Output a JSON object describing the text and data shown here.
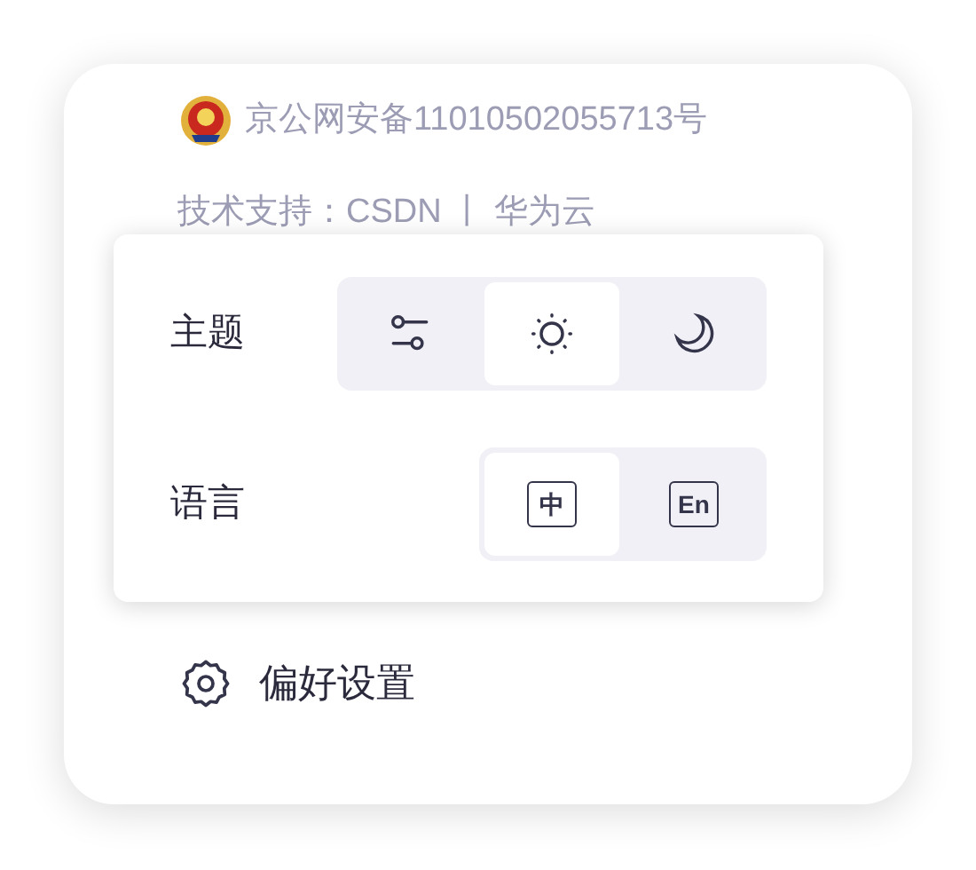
{
  "footer": {
    "icp": "京公网安备11010502055713号",
    "support": "技术支持：CSDN 丨 华为云"
  },
  "popover": {
    "theme": {
      "label": "主题",
      "options": [
        {
          "kind": "auto",
          "selected": false
        },
        {
          "kind": "light",
          "selected": true
        },
        {
          "kind": "dark",
          "selected": false
        }
      ]
    },
    "language": {
      "label": "语言",
      "options": [
        {
          "label": "中",
          "selected": true
        },
        {
          "label": "En",
          "selected": false
        }
      ]
    }
  },
  "menu_item": {
    "label": "偏好设置"
  }
}
